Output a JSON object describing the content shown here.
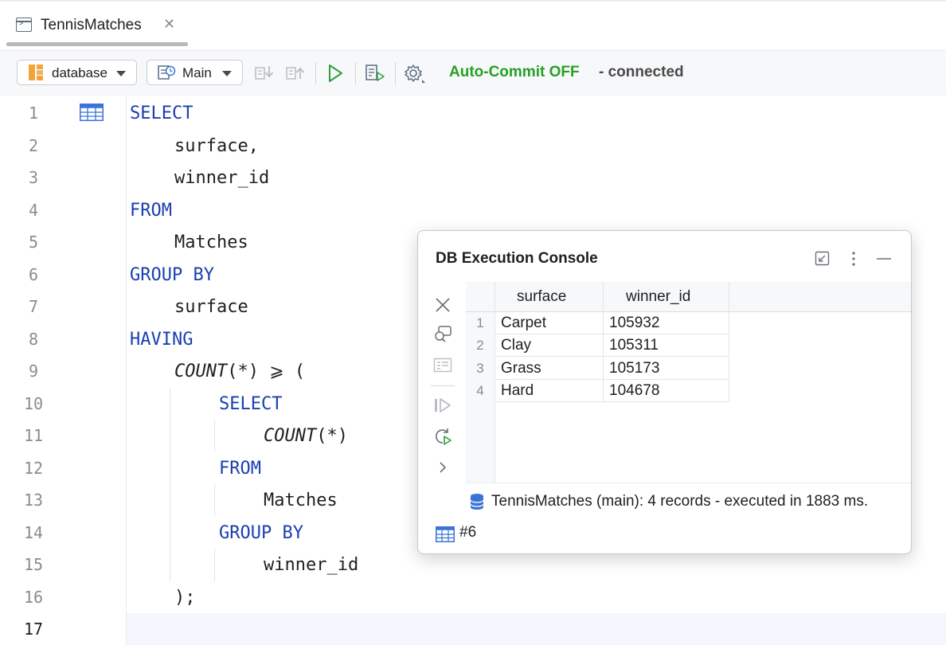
{
  "tab": {
    "label": "TennisMatches"
  },
  "toolbar": {
    "datasource_label": "database",
    "schema_label": "Main",
    "autocommit": "Auto-Commit OFF",
    "connection": "- connected"
  },
  "editor": {
    "line_numbers": [
      "1",
      "2",
      "3",
      "4",
      "5",
      "6",
      "7",
      "8",
      "9",
      "10",
      "11",
      "12",
      "13",
      "14",
      "15",
      "16",
      "17"
    ],
    "lines": {
      "l1": "SELECT",
      "l2": "surface,",
      "l3": "winner_id",
      "l4": "FROM",
      "l5": "Matches",
      "l6": "GROUP BY",
      "l7": "surface",
      "l8": "HAVING",
      "l9_fn": "COUNT",
      "l9_rest": "(*) ⩾ (",
      "l10": "SELECT",
      "l11_fn": "COUNT",
      "l11_rest": "(*)",
      "l12": "FROM",
      "l13": "Matches",
      "l14": "GROUP BY",
      "l15": "winner_id",
      "l16": ");"
    }
  },
  "console": {
    "title": "DB Execution Console",
    "columns": [
      "surface",
      "winner_id"
    ],
    "rows": [
      {
        "num": "1",
        "surface": "Carpet",
        "winner_id": "105932"
      },
      {
        "num": "2",
        "surface": "Clay",
        "winner_id": "105311"
      },
      {
        "num": "3",
        "surface": "Grass",
        "winner_id": "105173"
      },
      {
        "num": "4",
        "surface": "Hard",
        "winner_id": "104678"
      }
    ],
    "footer": "TennisMatches (main): 4 records  - executed in 1883 ms.",
    "result_tab": "#6"
  },
  "colors": {
    "keyword": "#1a3fb0",
    "autocommit": "#25a025",
    "run_icon": "#2e9e3e"
  }
}
